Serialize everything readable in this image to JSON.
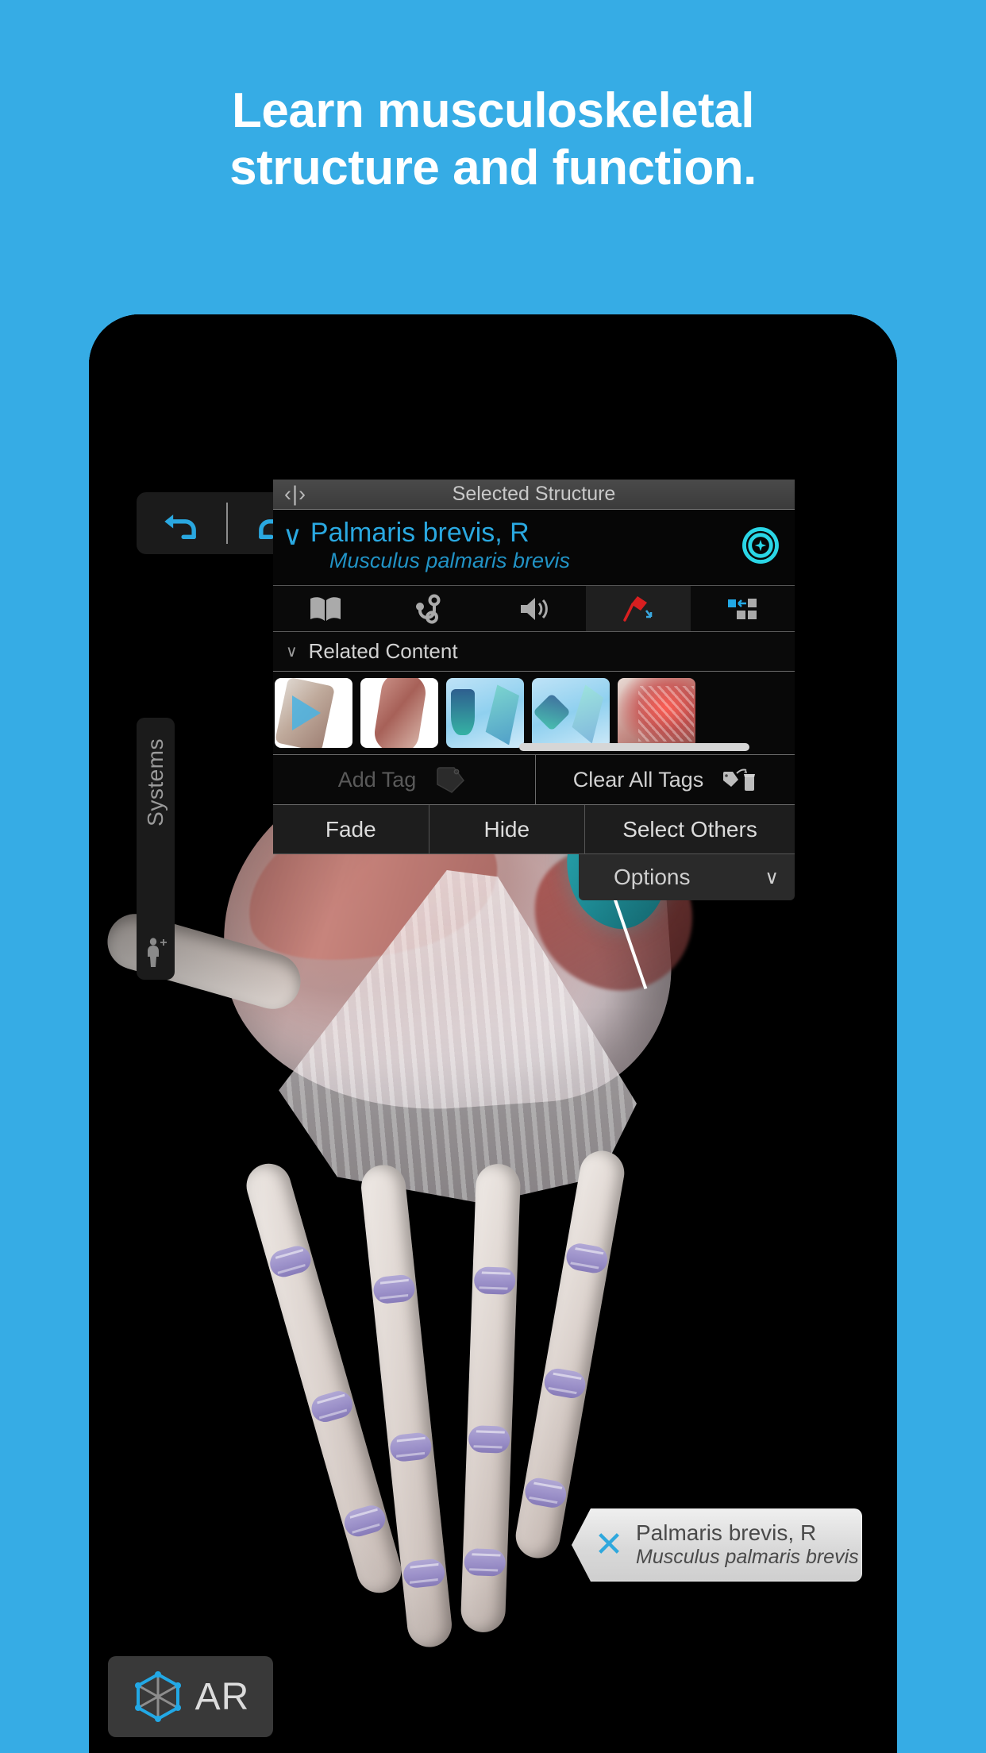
{
  "promo": {
    "headline_line1": "Learn musculoskeletal",
    "headline_line2": "structure and function.",
    "background_color": "#36ACE5",
    "text_color": "#FFFFFF"
  },
  "app": {
    "accent_color": "#2AA8E0",
    "panel_background": "#0B0B0B",
    "undo_redo": {
      "undo_label": "undo-arrow",
      "redo_label": "redo-arrow"
    },
    "sidebar": {
      "tab_label": "Systems",
      "icon": "body-plus-icon"
    },
    "panel": {
      "header_title": "Selected Structure",
      "nav_prev": "‹",
      "nav_sep": "|",
      "nav_next": "›",
      "structure_name": "Palmaris brevis, R",
      "structure_latin": "Musculus palmaris brevis",
      "expand_chevron": "∨",
      "target_icon": "target-crosshair-icon",
      "toolbar_icons": [
        {
          "name": "book-icon",
          "active": false
        },
        {
          "name": "stethoscope-icon",
          "active": false
        },
        {
          "name": "speaker-icon",
          "active": false
        },
        {
          "name": "pin-tag-icon",
          "active": true
        },
        {
          "name": "layout-panel-icon",
          "active": false
        }
      ],
      "related_content": {
        "chevron": "∨",
        "label": "Related Content",
        "thumbnails": [
          {
            "name": "video-hand-bones",
            "kind": "video"
          },
          {
            "name": "forearm-muscles",
            "kind": "image"
          },
          {
            "name": "wrist-joint-teal",
            "kind": "image"
          },
          {
            "name": "hand-joint-teal",
            "kind": "image"
          },
          {
            "name": "wrist-nerves-red",
            "kind": "image"
          }
        ]
      },
      "tag_buttons": {
        "add_tag_label": "Add Tag",
        "add_tag_icon": "tag-icon",
        "add_tag_disabled": true,
        "clear_all_label": "Clear All Tags",
        "clear_all_icon": "tag-trash-icon"
      },
      "actions": [
        {
          "label": "Fade"
        },
        {
          "label": "Hide"
        },
        {
          "label": "Select Others"
        }
      ],
      "options": {
        "label": "Options",
        "chevron": "∨"
      }
    },
    "callout": {
      "close_icon": "close-x-icon",
      "name": "Palmaris brevis, R",
      "latin": "Musculus palmaris brevis"
    },
    "ar_button": {
      "label": "AR",
      "icon": "ar-cube-icon"
    }
  }
}
